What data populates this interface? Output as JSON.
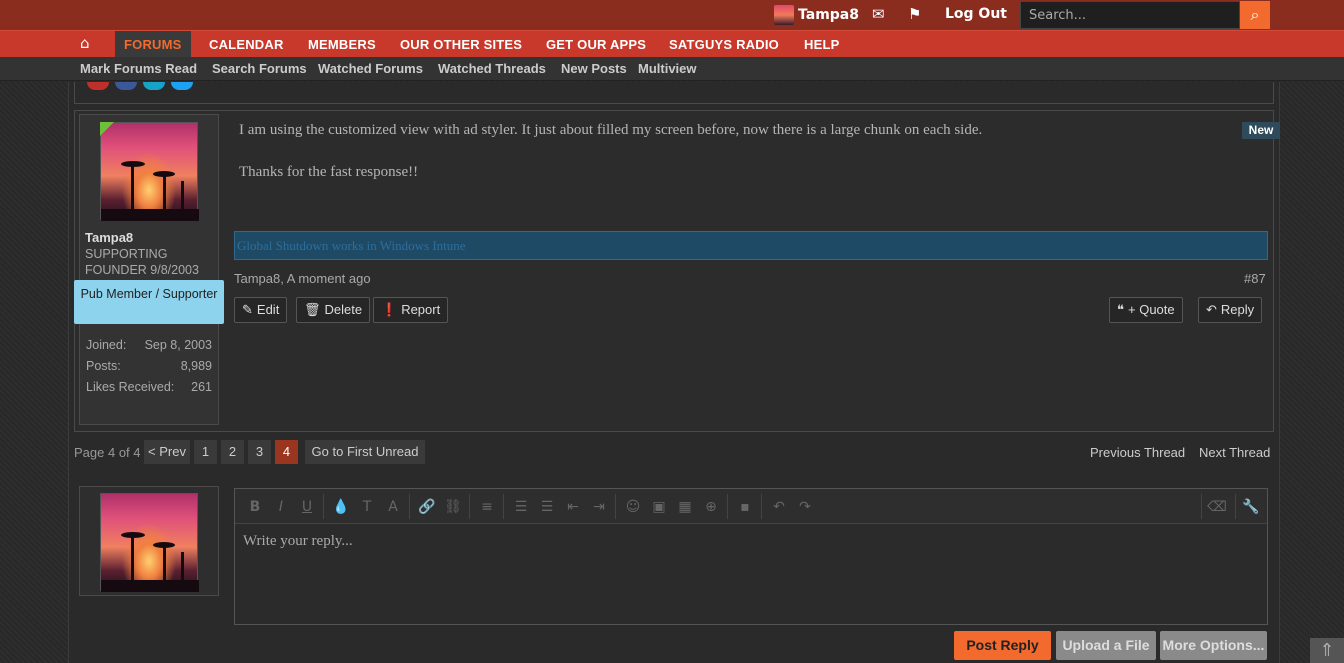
{
  "header": {
    "username": "Tampa8",
    "logout_label": "Log Out",
    "search_placeholder": "Search...",
    "icons": [
      "envelope-icon",
      "flag-icon",
      "search-icon"
    ]
  },
  "nav": {
    "tabs": [
      "FORUMS",
      "CALENDAR",
      "MEMBERS",
      "OUR OTHER SITES",
      "GET OUR APPS",
      "SATGUYS RADIO",
      "HELP"
    ],
    "active": "FORUMS"
  },
  "subnav": {
    "links": [
      "Mark Forums Read",
      "Search Forums",
      "Watched Forums",
      "Watched Threads",
      "New Posts",
      "Multiview"
    ]
  },
  "post": {
    "author": "Tampa8",
    "user_title": "SUPPORTING FOUNDER 9/8/2003",
    "badge": "Pub Member / Supporter",
    "stats": {
      "joined_label": "Joined:",
      "joined_value": "Sep 8, 2003",
      "posts_label": "Posts:",
      "posts_value": "8,989",
      "likes_label": "Likes Received:",
      "likes_value": "261"
    },
    "new_label": "New",
    "message_line1": "I am using the customized view with ad styler. It just about filled my screen before, now there is a large chunk on each side.",
    "message_line2": "Thanks for the fast response!!",
    "signature": "Global Shutdown works in Windows Intune",
    "meta": "Tampa8, A moment ago",
    "post_number": "#87",
    "buttons": {
      "edit": "Edit",
      "delete": "Delete",
      "report": "Report",
      "quote": "+ Quote",
      "reply": "Reply"
    }
  },
  "pager": {
    "label": "Page 4 of 4",
    "prev": "< Prev",
    "pages": [
      "1",
      "2",
      "3",
      "4"
    ],
    "current": "4",
    "first_unread": "Go to First Unread",
    "previous_thread": "Previous Thread",
    "next_thread": "Next Thread"
  },
  "reply": {
    "placeholder": "Write your reply...",
    "post_reply": "Post Reply",
    "upload": "Upload a File",
    "more_options": "More Options..."
  },
  "colors": {
    "topbar": "#8a2d1e",
    "navbar": "#c8392b",
    "accent": "#f26a2e",
    "badge": "#8dd3ee"
  }
}
